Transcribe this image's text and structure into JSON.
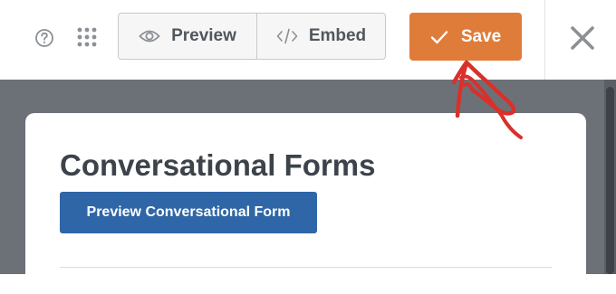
{
  "toolbar": {
    "help_icon": "question-circle-icon",
    "grid_icon": "grid-dots-icon",
    "preview_label": "Preview",
    "preview_icon": "eye-icon",
    "embed_label": "Embed",
    "embed_icon": "code-icon",
    "save_label": "Save",
    "save_icon": "checkmark-icon",
    "close_icon": "close-icon"
  },
  "card": {
    "title": "Conversational Forms",
    "button_label": "Preview Conversational Form"
  },
  "colors": {
    "save_button": "#df7c3a",
    "primary_button": "#2f66a7",
    "backdrop": "#6c7178",
    "annotation_arrow": "#d9302b"
  },
  "annotation": {
    "type": "hand-drawn-arrow",
    "points_to": "save-button"
  }
}
